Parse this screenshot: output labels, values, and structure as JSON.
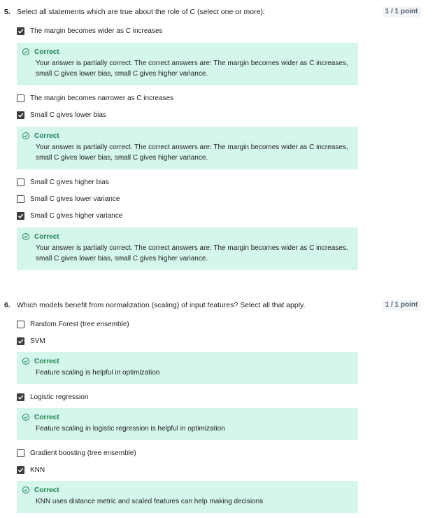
{
  "q5": {
    "number": "5.",
    "prompt": "Select all statements which are true about the role of C (select one or more):",
    "points": "1 / 1 point",
    "options": [
      {
        "label": "The margin becomes wider as C increases",
        "checked": true
      },
      {
        "label": "The margin becomes narrower as C increases",
        "checked": false
      },
      {
        "label": "Small C gives lower bias",
        "checked": true
      },
      {
        "label": "Small C gives higher bias",
        "checked": false
      },
      {
        "label": "Small C gives lower variance",
        "checked": false
      },
      {
        "label": "Small C gives higher variance",
        "checked": true
      }
    ],
    "feedback": [
      {
        "title": "Correct",
        "line1": "Your answer is partially correct. The correct answers are: The margin becomes wider as C increases,",
        "line2": "small C gives lower bias, small C gives higher variance."
      },
      {
        "title": "Correct",
        "line1": "Your answer is partially correct. The correct answers are: The margin becomes wider as C increases,",
        "line2": "small C gives lower bias, small C gives higher variance."
      },
      {
        "title": "Correct",
        "line1": "Your answer is partially correct. The correct answers are: The margin becomes wider as C increases,",
        "line2": "small C gives lower bias, small C gives higher variance."
      }
    ]
  },
  "q6": {
    "number": "6.",
    "prompt": "Which models benefit from normalization (scaling) of input features? Select all that apply.",
    "points": "1 / 1 point",
    "options": [
      {
        "label": "Random Forest (tree ensemble)",
        "checked": false
      },
      {
        "label": "SVM",
        "checked": true
      },
      {
        "label": "Logistic regression",
        "checked": true
      },
      {
        "label": "Gradient boosting (tree ensemble)",
        "checked": false
      },
      {
        "label": "KNN",
        "checked": true
      }
    ],
    "feedback": [
      {
        "title": "Correct",
        "text": "Feature scaling is helpful in optimization"
      },
      {
        "title": "Correct",
        "text": "Feature scaling in logistic regression is helpful in optimization"
      },
      {
        "title": "Correct",
        "text": "KNN uses distance metric and scaled features can help making decisions"
      }
    ]
  },
  "colors": {
    "correct": "#1f8354",
    "feedback_bg": "#d5f6ea",
    "checkbox": "#3c3c3c"
  },
  "icons": {
    "checkbox": "check-icon",
    "feedback": "check-circle-icon"
  }
}
